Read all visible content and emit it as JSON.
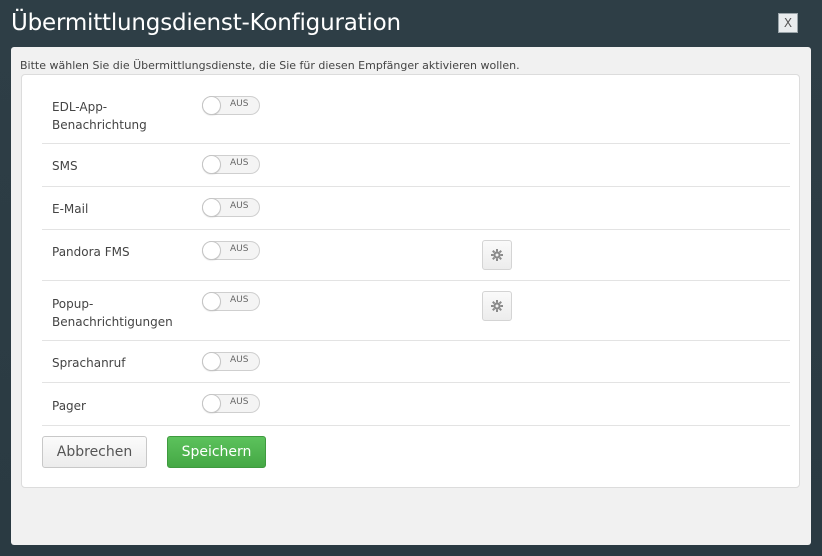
{
  "dialog": {
    "title": "Übermittlungsdienst-Konfiguration",
    "close_label": "X",
    "intro": "Bitte wählen Sie die Übermittlungsdienste, die Sie für diesen Empfänger aktivieren wollen."
  },
  "services": [
    {
      "label": "EDL-App-Benachrichtung",
      "state": "AUS",
      "has_settings": false
    },
    {
      "label": "SMS",
      "state": "AUS",
      "has_settings": false
    },
    {
      "label": "E-Mail",
      "state": "AUS",
      "has_settings": false
    },
    {
      "label": "Pandora FMS",
      "state": "AUS",
      "has_settings": true,
      "settings_icon": "gear-icon"
    },
    {
      "label": "Popup-Benachrichtigungen",
      "state": "AUS",
      "has_settings": true,
      "settings_icon": "gear-icon"
    },
    {
      "label": "Sprachanruf",
      "state": "AUS",
      "has_settings": false
    },
    {
      "label": "Pager",
      "state": "AUS",
      "has_settings": false
    }
  ],
  "footer": {
    "cancel_label": "Abbrechen",
    "save_label": "Speichern"
  },
  "colors": {
    "backdrop": "#2b3a42",
    "save_button": "#4cb34c",
    "panel": "#f1f1f1"
  }
}
